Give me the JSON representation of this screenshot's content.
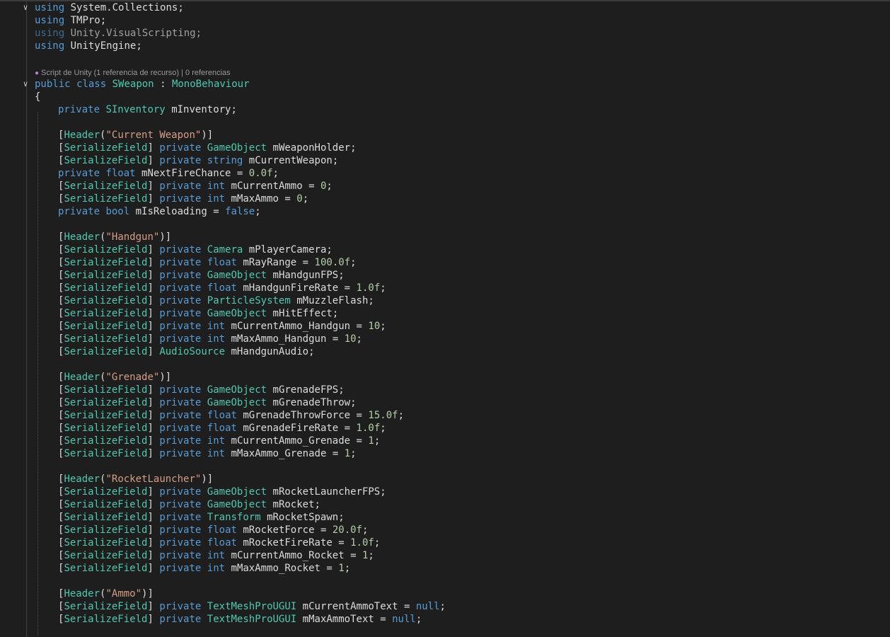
{
  "editor": {
    "usings": [
      {
        "kw": "using",
        "ns": "System.Collections",
        "punct": ";",
        "dimmed": false
      },
      {
        "kw": "using",
        "ns": "TMPro",
        "punct": ";",
        "dimmed": false
      },
      {
        "kw": "using",
        "ns": "Unity.VisualScripting",
        "punct": ";",
        "dimmed": true
      },
      {
        "kw": "using",
        "ns": "UnityEngine",
        "punct": ";",
        "dimmed": false
      }
    ],
    "codelens": {
      "icon": "unity-script-icon",
      "text": "Script de Unity (1 referencia de recurso) | 0 referencias"
    },
    "class_decl": {
      "kw1": "public",
      "kw2": "class",
      "name": "SWeapon",
      "colon": ":",
      "base": "MonoBehaviour"
    },
    "open_brace": "{",
    "inventory_line": {
      "kw": "private",
      "type": "SInventory",
      "name": "mInventory",
      "end": ";"
    },
    "sections": [
      {
        "header": "Current Weapon",
        "fields": [
          {
            "attr": true,
            "kw": "private",
            "type": "GameObject",
            "type_kind": "class",
            "name": "mWeaponHolder",
            "value": null
          },
          {
            "attr": true,
            "kw": "private",
            "type": "string",
            "type_kind": "keyword",
            "name": "mCurrentWeapon",
            "value": null
          },
          {
            "attr": false,
            "kw": "private",
            "type": "float",
            "type_kind": "keyword",
            "name": "mNextFireChance",
            "value": "0.0f",
            "value_kind": "number"
          },
          {
            "attr": true,
            "kw": "private",
            "type": "int",
            "type_kind": "keyword",
            "name": "mCurrentAmmo",
            "value": "0",
            "value_kind": "number"
          },
          {
            "attr": true,
            "kw": "private",
            "type": "int",
            "type_kind": "keyword",
            "name": "mMaxAmmo",
            "value": "0",
            "value_kind": "number"
          },
          {
            "attr": false,
            "kw": "private",
            "type": "bool",
            "type_kind": "keyword",
            "name": "mIsReloading",
            "value": "false",
            "value_kind": "keyword"
          }
        ]
      },
      {
        "header": "Handgun",
        "fields": [
          {
            "attr": true,
            "kw": "private",
            "type": "Camera",
            "type_kind": "class",
            "name": "mPlayerCamera",
            "value": null
          },
          {
            "attr": true,
            "kw": "private",
            "type": "float",
            "type_kind": "keyword",
            "name": "mRayRange",
            "value": "100.0f",
            "value_kind": "number"
          },
          {
            "attr": true,
            "kw": "private",
            "type": "GameObject",
            "type_kind": "class",
            "name": "mHandgunFPS",
            "value": null
          },
          {
            "attr": true,
            "kw": "private",
            "type": "float",
            "type_kind": "keyword",
            "name": "mHandgunFireRate",
            "value": "1.0f",
            "value_kind": "number"
          },
          {
            "attr": true,
            "kw": "private",
            "type": "ParticleSystem",
            "type_kind": "class",
            "name": "mMuzzleFlash",
            "value": null
          },
          {
            "attr": true,
            "kw": "private",
            "type": "GameObject",
            "type_kind": "class",
            "name": "mHitEffect",
            "value": null
          },
          {
            "attr": true,
            "kw": "private",
            "type": "int",
            "type_kind": "keyword",
            "name": "mCurrentAmmo_Handgun",
            "value": "10",
            "value_kind": "number"
          },
          {
            "attr": true,
            "kw": "private",
            "type": "int",
            "type_kind": "keyword",
            "name": "mMaxAmmo_Handgun",
            "value": "10",
            "value_kind": "number"
          },
          {
            "attr": true,
            "kw": "",
            "type": "AudioSource",
            "type_kind": "class",
            "name": "mHandgunAudio",
            "value": null
          }
        ]
      },
      {
        "header": "Grenade",
        "fields": [
          {
            "attr": true,
            "kw": "private",
            "type": "GameObject",
            "type_kind": "class",
            "name": "mGrenadeFPS",
            "value": null
          },
          {
            "attr": true,
            "kw": "private",
            "type": "GameObject",
            "type_kind": "class",
            "name": "mGrenadeThrow",
            "value": null
          },
          {
            "attr": true,
            "kw": "private",
            "type": "float",
            "type_kind": "keyword",
            "name": "mGrenadeThrowForce",
            "value": "15.0f",
            "value_kind": "number"
          },
          {
            "attr": true,
            "kw": "private",
            "type": "float",
            "type_kind": "keyword",
            "name": "mGrenadeFireRate",
            "value": "1.0f",
            "value_kind": "number"
          },
          {
            "attr": true,
            "kw": "private",
            "type": "int",
            "type_kind": "keyword",
            "name": "mCurrentAmmo_Grenade",
            "value": "1",
            "value_kind": "number"
          },
          {
            "attr": true,
            "kw": "private",
            "type": "int",
            "type_kind": "keyword",
            "name": "mMaxAmmo_Grenade",
            "value": "1",
            "value_kind": "number"
          }
        ]
      },
      {
        "header": "RocketLauncher",
        "fields": [
          {
            "attr": true,
            "kw": "private",
            "type": "GameObject",
            "type_kind": "class",
            "name": "mRocketLauncherFPS",
            "value": null
          },
          {
            "attr": true,
            "kw": "private",
            "type": "GameObject",
            "type_kind": "class",
            "name": "mRocket",
            "value": null
          },
          {
            "attr": true,
            "kw": "private",
            "type": "Transform",
            "type_kind": "class",
            "name": "mRocketSpawn",
            "value": null
          },
          {
            "attr": true,
            "kw": "private",
            "type": "float",
            "type_kind": "keyword",
            "name": "mRocketForce",
            "value": "20.0f",
            "value_kind": "number"
          },
          {
            "attr": true,
            "kw": "private",
            "type": "float",
            "type_kind": "keyword",
            "name": "mRocketFireRate",
            "value": "1.0f",
            "value_kind": "number"
          },
          {
            "attr": true,
            "kw": "private",
            "type": "int",
            "type_kind": "keyword",
            "name": "mCurrentAmmo_Rocket",
            "value": "1",
            "value_kind": "number"
          },
          {
            "attr": true,
            "kw": "private",
            "type": "int",
            "type_kind": "keyword",
            "name": "mMaxAmmo_Rocket",
            "value": "1",
            "value_kind": "number"
          }
        ]
      },
      {
        "header": "Ammo",
        "fields": [
          {
            "attr": true,
            "kw": "private",
            "type": "TextMeshProUGUI",
            "type_kind": "class",
            "name": "mCurrentAmmoText",
            "value": "null",
            "value_kind": "keyword"
          },
          {
            "attr": true,
            "kw": "private",
            "type": "TextMeshProUGUI",
            "type_kind": "class",
            "name": "mMaxAmmoText",
            "value": "null",
            "value_kind": "keyword"
          }
        ]
      }
    ],
    "tokens": {
      "header_attr": "Header",
      "serialize_attr": "SerializeField",
      "open_bracket": "[",
      "close_bracket": "]",
      "open_paren": "(",
      "close_paren": ")",
      "quote": "\"",
      "equals": "=",
      "semicolon": ";",
      "fold_glyph": "∨"
    },
    "colors": {
      "background": "#1e1e1e",
      "keyword": "#569cd6",
      "type": "#4ec9b0",
      "string": "#d69d85",
      "number": "#b5cea8",
      "text": "#dcdcdc",
      "codelens_icon": "#b180d7"
    }
  }
}
